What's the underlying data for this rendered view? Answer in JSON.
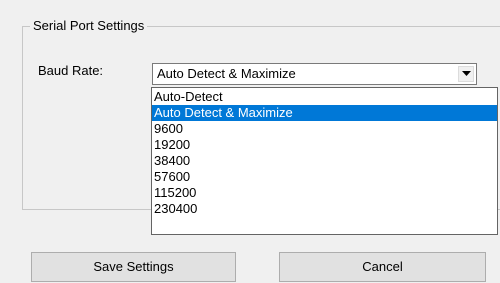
{
  "groupbox": {
    "title": "Serial Port Settings"
  },
  "baud_rate": {
    "label": "Baud Rate:",
    "selected_value": "Auto Detect & Maximize",
    "options": [
      "Auto-Detect",
      "Auto Detect & Maximize",
      "9600",
      "19200",
      "38400",
      "57600",
      "115200",
      "230400"
    ],
    "highlighted_index": 1
  },
  "buttons": {
    "save_label": "Save Settings",
    "cancel_label": "Cancel"
  },
  "icons": {
    "combo_arrow": "chevron-down-icon"
  },
  "colors": {
    "highlight": "#0078d7",
    "background": "#f0f0f0"
  }
}
